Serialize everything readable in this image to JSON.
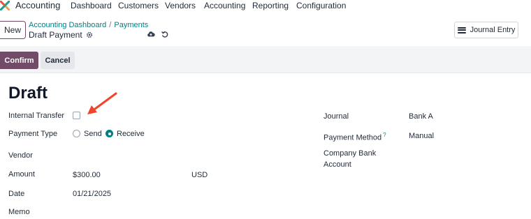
{
  "navbar": {
    "app_name": "Accounting",
    "items": [
      "Dashboard",
      "Customers",
      "Vendors",
      "Accounting",
      "Reporting",
      "Configuration"
    ]
  },
  "control_panel": {
    "new_label": "New",
    "breadcrumb": [
      "Accounting Dashboard",
      "Payments"
    ],
    "breadcrumb_sep": "/",
    "record_name": "Draft Payment",
    "journal_entry_label": "Journal Entry"
  },
  "actions": {
    "confirm_label": "Confirm",
    "cancel_label": "Cancel"
  },
  "form": {
    "status_title": "Draft",
    "internal_transfer_label": "Internal Transfer",
    "internal_transfer_checked": false,
    "payment_type_label": "Payment Type",
    "payment_type_options": [
      "Send",
      "Receive"
    ],
    "payment_type_selected": "Receive",
    "vendor_label": "Vendor",
    "amount_label": "Amount",
    "amount_value": "$300.00",
    "currency_value": "USD",
    "date_label": "Date",
    "date_value": "01/21/2025",
    "memo_label": "Memo",
    "journal_label": "Journal",
    "journal_value": "Bank A",
    "payment_method_label": "Payment Method",
    "payment_method_help": "?",
    "payment_method_value": "Manual",
    "company_bank_account_label_line1": "Company Bank",
    "company_bank_account_label_line2": "Account"
  },
  "colors": {
    "brand": "#714b67",
    "link": "#017e84",
    "annotation_arrow": "#f0452a"
  },
  "icons": [
    "app-logo-icon",
    "gear-icon",
    "cloud-upload-icon",
    "undo-icon",
    "hamburger-menu-icon",
    "annotation-arrow-icon"
  ]
}
